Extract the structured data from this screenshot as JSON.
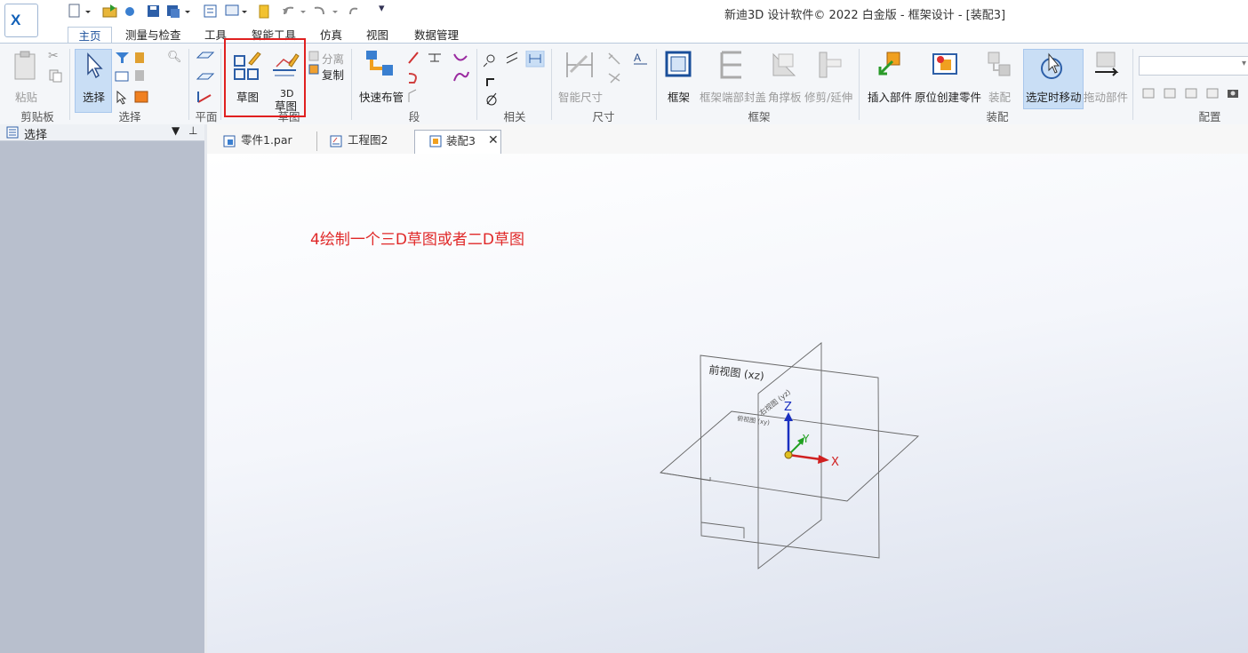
{
  "app": {
    "window_title": "新迪3D 设计软件© 2022 白金版 - 框架设计 - [装配3]"
  },
  "tabs": [
    {
      "label": "主页"
    },
    {
      "label": "测量与检查"
    },
    {
      "label": "工具"
    },
    {
      "label": "智能工具"
    },
    {
      "label": "仿真"
    },
    {
      "label": "视图"
    },
    {
      "label": "数据管理"
    }
  ],
  "ribbon": {
    "clipboard": {
      "paste": "粘贴",
      "group": "剪贴板"
    },
    "select": {
      "select": "选择",
      "group": "选择"
    },
    "plane": {
      "group": "平面"
    },
    "sketch": {
      "sketch": "草图",
      "sketch3d_top": "3D",
      "sketch3d_bottom": "草图",
      "split": "分离",
      "copy": "复制",
      "group": "草图"
    },
    "segment": {
      "route": "快速布管",
      "group": "段"
    },
    "related": {
      "group": "相关"
    },
    "dimension": {
      "smart": "智能尺寸",
      "group": "尺寸"
    },
    "frame": {
      "frame": "框架",
      "endcap": "框架端部封盖",
      "gusset": "角撑板",
      "trim": "修剪/延伸",
      "group": "框架"
    },
    "assembly": {
      "insert": "插入部件",
      "inplace": "原位创建零件",
      "assemble": "装配",
      "move": "选定时移动",
      "drag": "拖动部件",
      "group": "装配"
    },
    "config": {
      "group": "配置"
    }
  },
  "panel": {
    "title": "选择"
  },
  "doc_tabs": [
    {
      "label": "零件1.par"
    },
    {
      "label": "工程图2"
    },
    {
      "label": "装配3"
    }
  ],
  "viewport": {
    "annotation": "4绘制一个三D草图或者二D草图",
    "front_plane": "前视图 (xz)",
    "right_plane": "右视图 (yz)",
    "top_plane": "俯视图 (xy)",
    "axis_x": "X",
    "axis_y": "Y",
    "axis_z": "Z"
  },
  "colors": {
    "accent": "#1a4f9a",
    "annotation": "#e02828",
    "highlight_box": "#e02020"
  }
}
